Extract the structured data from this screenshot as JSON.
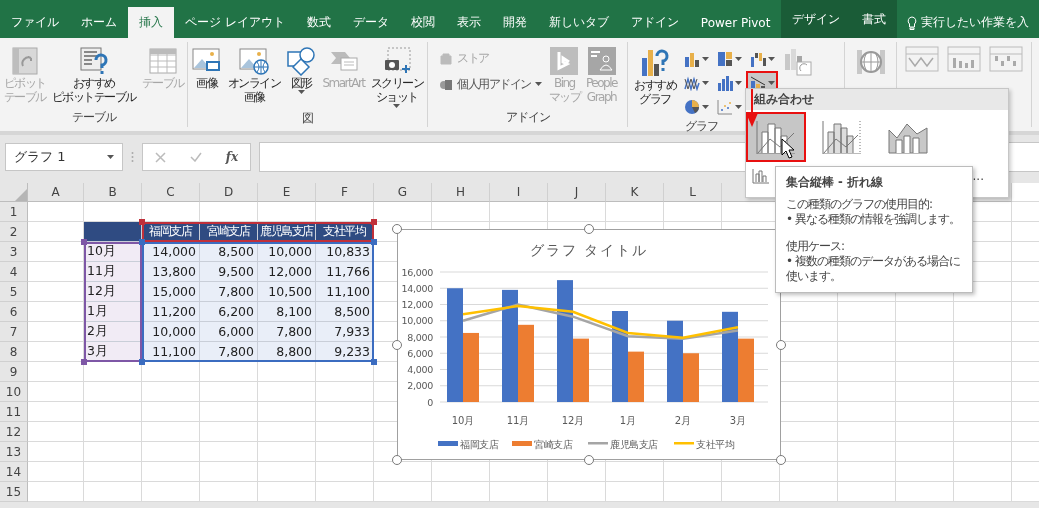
{
  "ribbon_tabs": [
    {
      "label": "ファイル",
      "selected": false,
      "contextual": false
    },
    {
      "label": "ホーム",
      "selected": false,
      "contextual": false
    },
    {
      "label": "挿入",
      "selected": true,
      "contextual": false
    },
    {
      "label": "ページ レイアウト",
      "selected": false,
      "contextual": false
    },
    {
      "label": "数式",
      "selected": false,
      "contextual": false
    },
    {
      "label": "データ",
      "selected": false,
      "contextual": false
    },
    {
      "label": "校閲",
      "selected": false,
      "contextual": false
    },
    {
      "label": "表示",
      "selected": false,
      "contextual": false
    },
    {
      "label": "開発",
      "selected": false,
      "contextual": false
    },
    {
      "label": "新しいタブ",
      "selected": false,
      "contextual": false
    },
    {
      "label": "アドイン",
      "selected": false,
      "contextual": false
    },
    {
      "label": "Power Pivot",
      "selected": false,
      "contextual": false
    },
    {
      "label": "デザイン",
      "selected": false,
      "contextual": true
    },
    {
      "label": "書式",
      "selected": false,
      "contextual": true
    }
  ],
  "tell_me": "実行したい作業を入",
  "ribbon_groups": [
    {
      "label": "テーブル",
      "buttons": [
        {
          "kind": "large",
          "lines": [
            "ピボット",
            "テーブル"
          ],
          "disabled": true,
          "menu": false
        },
        {
          "kind": "large",
          "lines": [
            "おすすめ",
            "ピボットテーブル"
          ],
          "disabled": false,
          "menu": false
        },
        {
          "kind": "large",
          "lines": [
            "テーブル"
          ],
          "disabled": true,
          "menu": false
        }
      ]
    },
    {
      "label": "図",
      "buttons": [
        {
          "kind": "large",
          "lines": [
            "画像"
          ],
          "disabled": false,
          "menu": false
        },
        {
          "kind": "large",
          "lines": [
            "オンライン",
            "画像"
          ],
          "disabled": false,
          "menu": false
        },
        {
          "kind": "large",
          "lines": [
            "図形"
          ],
          "disabled": false,
          "menu": true
        },
        {
          "kind": "large",
          "lines": [
            "SmartArt"
          ],
          "disabled": true,
          "menu": false
        },
        {
          "kind": "large",
          "lines": [
            "スクリーン",
            "ショット"
          ],
          "disabled": false,
          "menu": true
        }
      ]
    },
    {
      "label": "アドイン",
      "buttons": [
        {
          "kind": "stack",
          "items": [
            {
              "label": "ストア",
              "disabled": true,
              "menu": false
            },
            {
              "label": "個人用アドイン",
              "disabled": false,
              "menu": true
            }
          ]
        },
        {
          "kind": "large",
          "lines": [
            "Bing",
            "マップ"
          ],
          "disabled": true,
          "menu": false
        },
        {
          "kind": "large",
          "lines": [
            "People",
            "Graph"
          ],
          "disabled": true,
          "menu": false
        }
      ]
    },
    {
      "label": "グラフ",
      "buttons": [
        {
          "kind": "large",
          "lines": [
            "おすすめ",
            "グラフ"
          ],
          "disabled": false,
          "menu": false
        },
        {
          "kind": "gallery",
          "items": [
            {
              "pressed": false,
              "annotated": false
            },
            {
              "pressed": false,
              "annotated": false
            },
            {
              "pressed": false,
              "annotated": false
            },
            {
              "pressed": false,
              "annotated": false
            },
            {
              "pressed": false,
              "annotated": false
            },
            {
              "pressed": true,
              "annotated": true
            },
            {
              "pressed": false,
              "annotated": false
            },
            {
              "pressed": false,
              "annotated": false
            }
          ]
        },
        {
          "kind": "icon"
        }
      ]
    },
    {
      "buttons": [
        {
          "kind": "icon"
        }
      ]
    },
    {
      "buttons": [
        {
          "kind": "icon"
        },
        {
          "kind": "icon"
        },
        {
          "kind": "icon"
        }
      ]
    }
  ],
  "formula_bar": {
    "name_box": "グラフ 1",
    "fx": "fx"
  },
  "sheet": {
    "columns": [
      "A",
      "B",
      "C",
      "D",
      "E",
      "F",
      "G",
      "H",
      "I",
      "J",
      "K",
      "L"
    ],
    "rows": [
      "1",
      "2",
      "3",
      "4",
      "5",
      "6",
      "7",
      "8",
      "9",
      "10",
      "11",
      "12",
      "13",
      "14",
      "15"
    ]
  },
  "table": {
    "columns": [
      "福岡支店",
      "宮崎支店",
      "鹿児島支店",
      "支社平均"
    ],
    "rows": [
      {
        "label": "10月",
        "values": [
          "14,000",
          "8,500",
          "10,000",
          "10,833"
        ]
      },
      {
        "label": "11月",
        "values": [
          "13,800",
          "9,500",
          "12,000",
          "11,766"
        ]
      },
      {
        "label": "12月",
        "values": [
          "15,000",
          "7,800",
          "10,500",
          "11,100"
        ]
      },
      {
        "label": "1月",
        "values": [
          "11,200",
          "6,200",
          "8,100",
          "8,500"
        ]
      },
      {
        "label": "2月",
        "values": [
          "10,000",
          "6,000",
          "7,800",
          "7,933"
        ]
      },
      {
        "label": "3月",
        "values": [
          "11,100",
          "7,800",
          "8,800",
          "9,233"
        ]
      }
    ]
  },
  "chart": {
    "selected": true,
    "chart_data": {
      "type": "bar",
      "title": "グラフ タイトル",
      "stacked": false,
      "grid": true,
      "legend": true,
      "categories": [
        "10月",
        "11月",
        "12月",
        "1月",
        "2月",
        "3月"
      ],
      "series": [
        {
          "name": "福岡支店",
          "color": "#4472c4",
          "type": "bar",
          "values": [
            14000,
            13800,
            15000,
            11200,
            10000,
            11100
          ]
        },
        {
          "name": "宮崎支店",
          "color": "#ed7d31",
          "type": "bar",
          "values": [
            8500,
            9500,
            7800,
            6200,
            6000,
            7800
          ]
        },
        {
          "name": "鹿児島支店",
          "color": "#a5a5a5",
          "type": "line",
          "values": [
            10000,
            12000,
            10500,
            8100,
            7800,
            8800
          ]
        },
        {
          "name": "支社平均",
          "color": "#ffc000",
          "type": "line",
          "values": [
            10800,
            11800,
            11100,
            8500,
            7900,
            9200
          ]
        }
      ],
      "ylim": [
        0,
        16000
      ],
      "yticks": [
        {
          "value": 0,
          "label": "0"
        },
        {
          "value": 2000,
          "label": "2,000"
        },
        {
          "value": 4000,
          "label": "4,000"
        },
        {
          "value": 6000,
          "label": "6,000"
        },
        {
          "value": 8000,
          "label": "8,000"
        },
        {
          "value": 10000,
          "label": "10,000"
        },
        {
          "value": 12000,
          "label": "12,000"
        },
        {
          "value": 14000,
          "label": "14,000"
        },
        {
          "value": 16000,
          "label": "16,000"
        }
      ]
    }
  },
  "combo_menu": {
    "title": "組み合わせ",
    "options": [
      {
        "selected": true,
        "annotated": true
      },
      {
        "selected": false,
        "annotated": false
      },
      {
        "selected": false,
        "annotated": false
      }
    ],
    "more_label": "..."
  },
  "tooltip": {
    "title": "集合縦棒 - 折れ線",
    "sections": [
      {
        "heading": "この種類のグラフの使用目的:",
        "bullets": [
          "• 異なる種類の情報を強調します。"
        ]
      },
      {
        "heading": "使用ケース:",
        "bullets": [
          "• 複数の種類のデータがある場合に使います。"
        ]
      }
    ]
  }
}
